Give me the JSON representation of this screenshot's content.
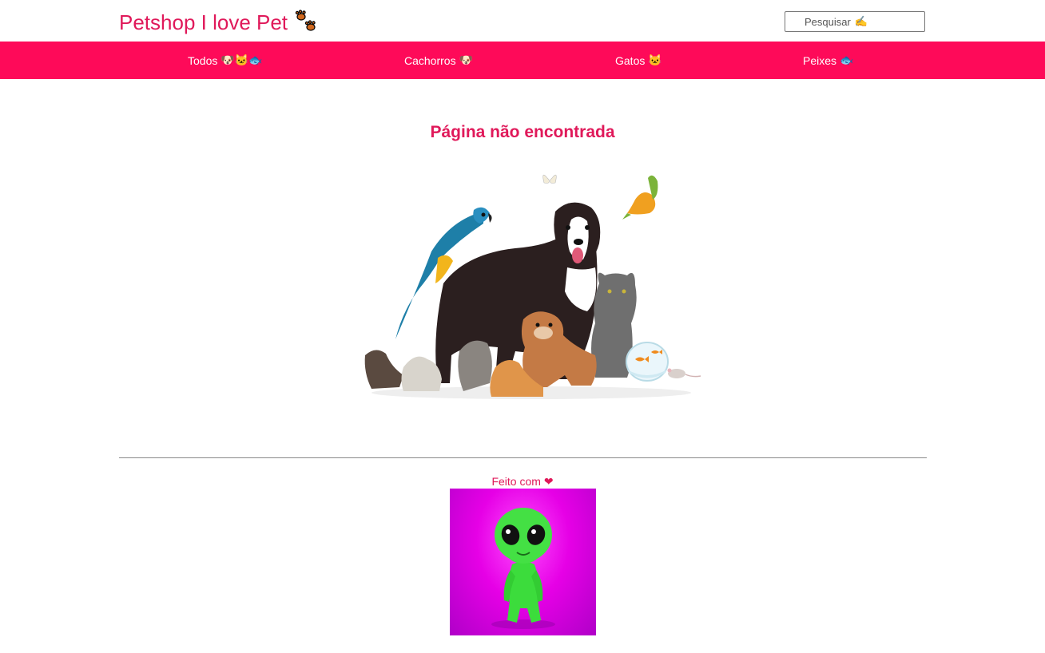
{
  "header": {
    "logo_text": "Petshop I love Pet",
    "search_placeholder": "Pesquisar",
    "search_icon": "pencil-icon"
  },
  "nav": {
    "items": [
      {
        "label": "Todos",
        "emoji": "🐶🐱🐟"
      },
      {
        "label": "Cachorros",
        "emoji": "🐶"
      },
      {
        "label": "Gatos",
        "emoji": "🐱"
      },
      {
        "label": "Peixes",
        "emoji": "🐟"
      }
    ]
  },
  "main": {
    "title": "Página não encontrada"
  },
  "footer": {
    "made_with": "Feito com"
  },
  "colors": {
    "brand": "#e0195a",
    "navbar": "#fe0a59"
  }
}
